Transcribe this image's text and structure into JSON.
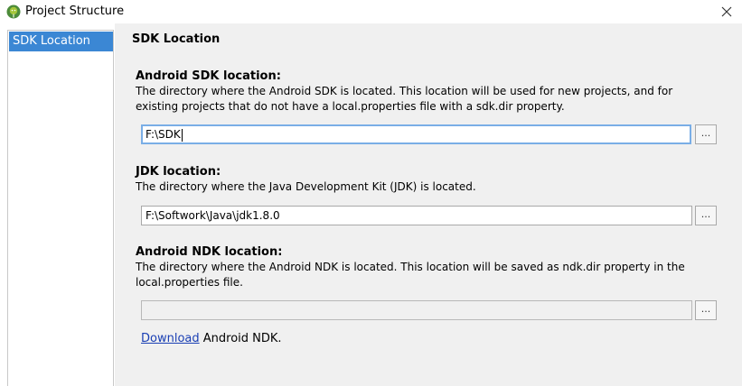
{
  "window": {
    "title": "Project Structure",
    "app_icon": "android-studio-icon",
    "close_icon": "close-icon"
  },
  "sidebar": {
    "items": [
      {
        "label": "SDK Location",
        "selected": true
      }
    ]
  },
  "main": {
    "section_title": "SDK Location",
    "android_sdk": {
      "heading": "Android SDK location:",
      "description": "The directory where the Android SDK is located. This location will be used for new projects, and for existing projects that do not have a local.properties file with a sdk.dir property.",
      "value": "F:\\SDK",
      "browse_label": "..."
    },
    "jdk": {
      "heading": "JDK location:",
      "description": "The directory where the Java Development Kit (JDK) is located.",
      "value": "F:\\Softwork\\Java\\jdk1.8.0",
      "browse_label": "..."
    },
    "android_ndk": {
      "heading": "Android NDK location:",
      "description": "The directory where the Android NDK is located. This location will be saved as ndk.dir property in the local.properties file.",
      "value": "",
      "browse_label": "...",
      "download_link": "Download",
      "download_suffix": "Android NDK."
    }
  },
  "colors": {
    "selection": "#3b87d4",
    "focus_border": "#7aaee6",
    "link": "#1a3fb4"
  }
}
